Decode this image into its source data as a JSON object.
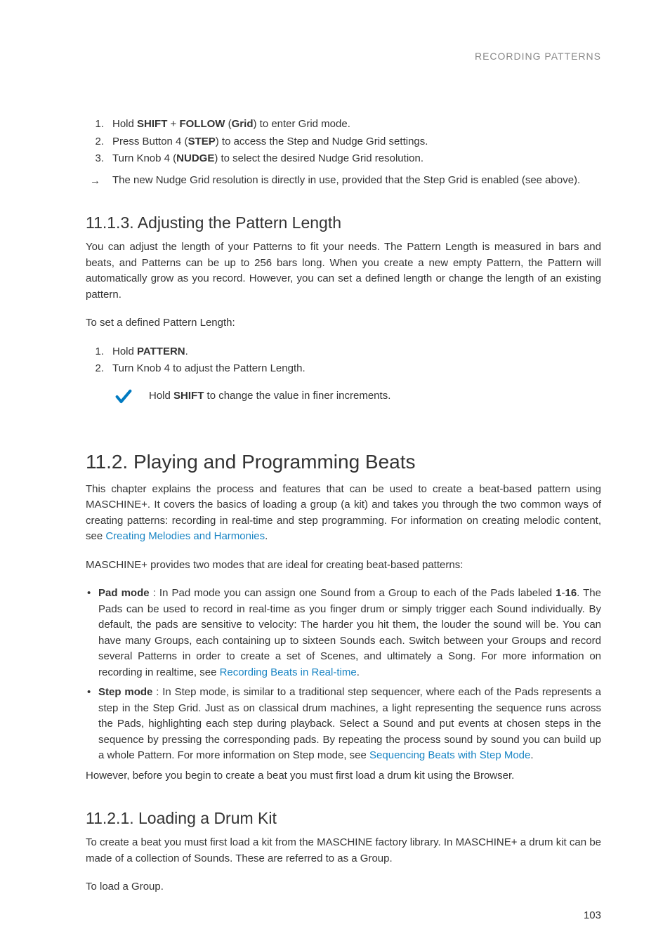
{
  "header": {
    "title": "RECORDING PATTERNS"
  },
  "intro_list": {
    "item1": {
      "num": "1.",
      "pre": "Hold ",
      "b1": "SHIFT",
      "mid1": " + ",
      "b2": "FOLLOW",
      "mid2": " (",
      "b3": "Grid",
      "post": ") to enter Grid mode."
    },
    "item2": {
      "num": "2.",
      "pre": "Press Button 4 (",
      "b1": "STEP",
      "post": ") to access the Step and Nudge Grid settings."
    },
    "item3": {
      "num": "3.",
      "pre": "Turn Knob 4 (",
      "b1": "NUDGE",
      "post": ") to select the desired Nudge Grid resolution."
    },
    "arrow": {
      "sym": "→",
      "text": "The new Nudge Grid resolution is directly in use, provided that the Step Grid is enabled (see above)."
    }
  },
  "sec1113": {
    "title": "11.1.3. Adjusting the Pattern Length",
    "p1": "You can adjust the length of your Patterns to fit your needs. The Pattern Length is measured in bars and beats, and Patterns can be up to 256 bars long. When you create a new empty Pattern, the Pattern will automatically grow as you record. However, you can set a defined length or change the length of an existing pattern.",
    "p2": "To set a defined Pattern Length:",
    "list": {
      "i1": {
        "num": "1.",
        "pre": "Hold ",
        "b1": "PATTERN",
        "post": "."
      },
      "i2": {
        "num": "2.",
        "text": "Turn Knob 4 to adjust the Pattern Length."
      }
    },
    "tip": {
      "pre": "Hold ",
      "b1": "SHIFT",
      "post": " to change the value in finer increments."
    }
  },
  "sec112": {
    "title": "11.2. Playing and Programming Beats",
    "p1_a": "This chapter explains the process and features that can be used to create a beat-based pattern using MASCHINE+. It covers the basics of loading a group (a kit) and takes you through the two common ways of creating patterns: recording in real-time and step programming. For information on creating melodic content, see ",
    "p1_link": "Creating Melodies and Harmonies",
    "p1_b": ".",
    "p2": "MASCHINE+ provides two modes that are ideal for creating beat-based patterns:",
    "bullets": {
      "pad": {
        "b1": "Pad mode",
        "mid1": " : In Pad mode you can assign one Sound from a Group to each of the Pads labeled ",
        "b2": "1",
        "dash": "-",
        "b3": "16",
        "mid2": ". The Pads can be used to record in real-time as you finger drum or simply trigger each Sound individually. By default, the pads are sensitive to velocity: The harder you hit them, the louder the sound will be. You can have many Groups, each containing up to sixteen Sounds each. Switch between your Groups and record several Patterns in order to create a set of Scenes, and ultimately a Song. For more information on recording in realtime, see ",
        "link": "Recording Beats in Real-time",
        "post": "."
      },
      "step": {
        "b1": "Step mode",
        "mid1": " : In Step mode, is similar to a traditional step sequencer, where each of the Pads represents a step in the Step Grid. Just as on classical drum machines, a light representing the sequence runs across the Pads, highlighting each step during playback. Select a Sound and put events at chosen steps in the sequence by pressing the corresponding pads. By repeating the process sound by sound you can build up a whole Pattern. For more information on Step mode, see ",
        "link": "Sequencing Beats with Step Mode",
        "post": "."
      }
    },
    "p3": "However, before you begin to create a beat you must first load a drum kit using the Browser."
  },
  "sec1121": {
    "title": "11.2.1. Loading a Drum Kit",
    "p1": "To create a beat you must first load a kit from the MASCHINE factory library. In MASCHINE+ a drum kit can be made of a collection of Sounds. These are referred to as a Group.",
    "p2": "To load a Group."
  },
  "page_number": "103"
}
